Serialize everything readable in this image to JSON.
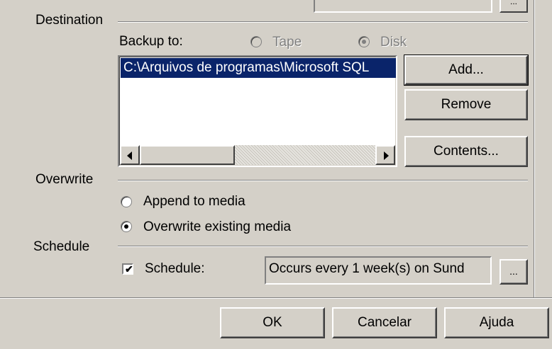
{
  "destination": {
    "heading": "Destination",
    "backup_to_label": "Backup to:",
    "tape_label": "Tape",
    "disk_label": "Disk",
    "list_items": [
      "C:\\Arquivos de programas\\Microsoft SQL"
    ],
    "add_label": "Add...",
    "remove_label": "Remove",
    "contents_label": "Contents..."
  },
  "overwrite": {
    "heading": "Overwrite",
    "append_label": "Append to media",
    "overwrite_label": "Overwrite existing media"
  },
  "schedule": {
    "heading": "Schedule",
    "checkbox_label": "Schedule:",
    "value": "Occurs every 1 week(s) on Sund",
    "browse_label": "..."
  },
  "footer": {
    "ok_label": "OK",
    "cancel_label": "Cancelar",
    "help_label": "Ajuda"
  },
  "top": {
    "browse_label": "..."
  }
}
